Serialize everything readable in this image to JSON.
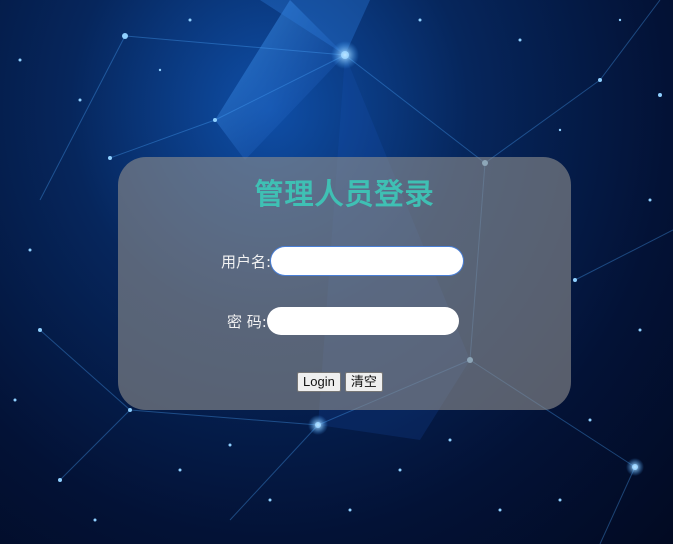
{
  "login_form": {
    "title": "管理人员登录",
    "username_label": "用户名:",
    "username_value": "",
    "password_label": "密 码:",
    "password_value": "",
    "login_button": "Login",
    "clear_button": "清空"
  },
  "colors": {
    "title": "#3fc0b4",
    "panel": "rgba(140,140,140,0.62)",
    "background": "#031236",
    "focus_border": "#4a7fd6"
  }
}
